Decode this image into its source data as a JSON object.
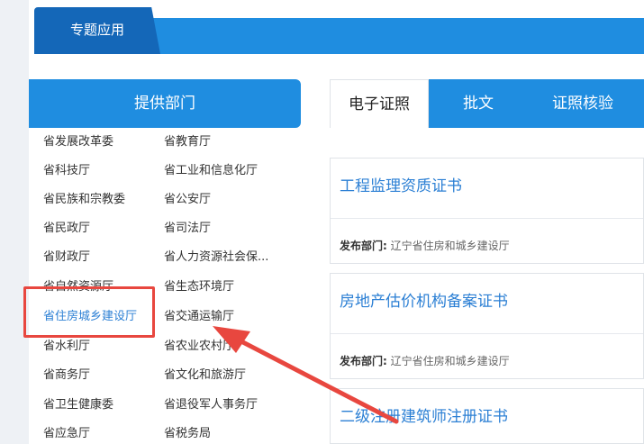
{
  "header": {
    "tab_label": "专题应用"
  },
  "providers": {
    "title": "提供部门",
    "col1": [
      "省发展改革委",
      "省科技厅",
      "省民族和宗教委",
      "省民政厅",
      "省财政厅",
      "省自然资源厅",
      "省住房城乡建设厅",
      "省水利厅",
      "省商务厅",
      "省卫生健康委",
      "省应急厅"
    ],
    "col2": [
      "省教育厅",
      "省工业和信息化厅",
      "省公安厅",
      "省司法厅",
      "省人力资源社会保...",
      "省生态环境厅",
      "省交通运输厅",
      "省农业农村厅",
      "省文化和旅游厅",
      "省退役军人事务厅",
      "省税务局"
    ]
  },
  "tabs": [
    "电子证照",
    "批文",
    "证照核验"
  ],
  "cards": [
    {
      "title": "工程监理资质证书",
      "meta_label": "发布部门:",
      "meta_value": "辽宁省住房和城乡建设厅"
    },
    {
      "title": "房地产估价机构备案证书",
      "meta_label": "发布部门:",
      "meta_value": "辽宁省住房和城乡建设厅"
    },
    {
      "title": "二级注册建筑师注册证书",
      "meta_label": "",
      "meta_value": ""
    }
  ],
  "colors": {
    "primary": "#1f8de0",
    "dark_tab": "#1467b8",
    "highlight": "#e8473f",
    "link": "#2b7fd4"
  }
}
